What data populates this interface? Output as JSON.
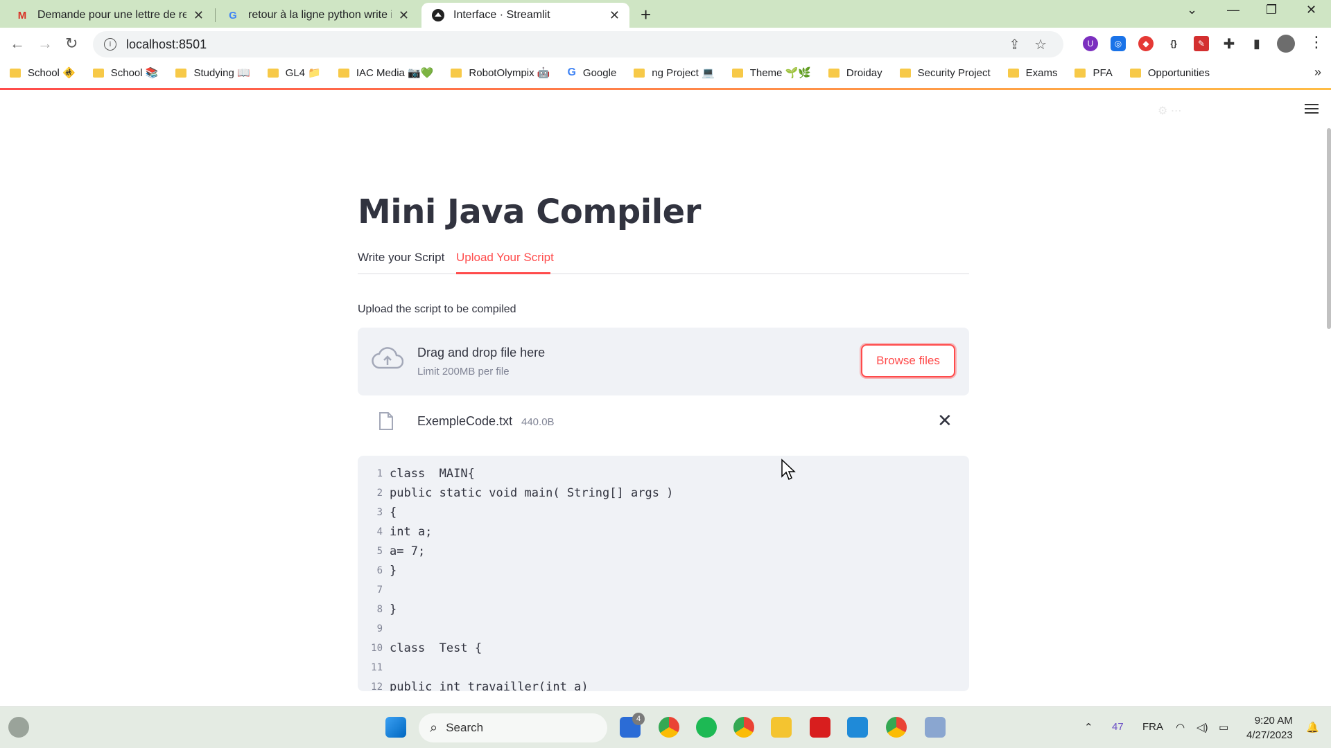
{
  "browser": {
    "tabs": [
      {
        "title": "Demande pour une lettre de recc",
        "icon": "gmail-icon"
      },
      {
        "title": "retour à la ligne python write in f",
        "icon": "google-icon"
      },
      {
        "title": "Interface · Streamlit",
        "icon": "streamlit-icon"
      }
    ],
    "url": "localhost:8501",
    "bookmarks": [
      "School 🚸",
      "School 📚",
      "Studying 📖",
      "GL4 📁",
      "IAC Media 📷💚",
      "RobotOlympix 🤖",
      "Google",
      "ng Project 💻",
      "Theme 🌱🌿",
      "Droiday",
      "Security Project",
      "Exams",
      "PFA",
      "Opportunities"
    ],
    "bookmark_more": "»"
  },
  "app": {
    "title": "Mini Java Compiler",
    "tabs": [
      "Write your Script",
      "Upload Your Script"
    ],
    "active_tab": "Upload Your Script",
    "upload_label": "Upload the script to be compiled",
    "dropzone_text": "Drag and drop file here",
    "dropzone_limit": "Limit 200MB per file",
    "browse_label": "Browse files",
    "file_name": "ExempleCode.txt",
    "file_size": "440.0B",
    "accent_color": "#ff4b4b",
    "code_lines": [
      "class  MAIN{",
      "public static void main( String[] args )",
      "{",
      "int a;",
      "a= 7;",
      "}",
      "",
      "}",
      "",
      "class  Test {",
      "",
      "public int travailler(int a)"
    ]
  },
  "taskbar": {
    "search_label": "Search",
    "badge_count": "4",
    "temperature": "47",
    "language": "FRA",
    "time": "9:20 AM",
    "date": "4/27/2023"
  }
}
